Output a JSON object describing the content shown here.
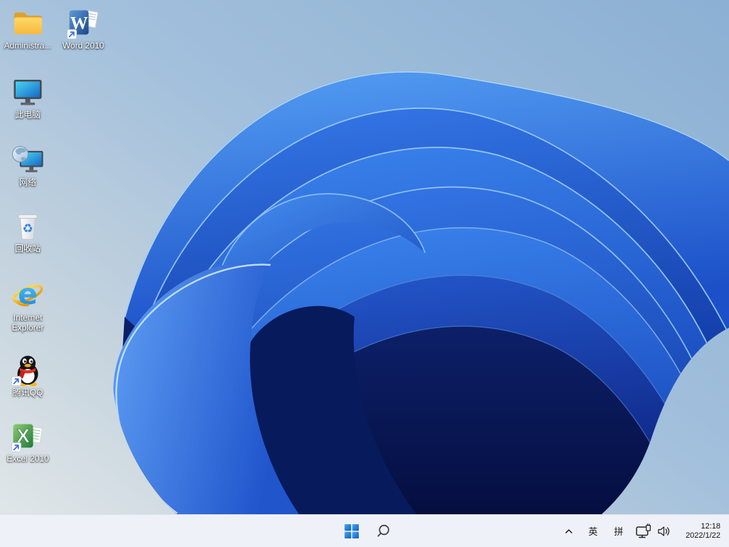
{
  "desktop": {
    "icons": [
      {
        "label": "Administra..."
      },
      {
        "label": "Word 2010"
      },
      {
        "label": "此电脑"
      },
      {
        "label": "网络"
      },
      {
        "label": "回收站"
      },
      {
        "label": "Internet Explorer"
      },
      {
        "label": "腾讯QQ"
      },
      {
        "label": "Excel 2010"
      }
    ],
    "icon_glyphs": {
      "word": "W",
      "excel": "X",
      "ie": "e",
      "recycle": "♻"
    }
  },
  "taskbar": {
    "start_icon": "windows-11-logo",
    "search_icon": "magnifier",
    "tray": {
      "chevron_icon": "chevron-up",
      "ime_language": "英",
      "ime_layout": "拼",
      "network_icon": "ethernet-display",
      "volume_icon": "speaker",
      "time": "12:18",
      "date": "2022/1/22"
    }
  },
  "wallpaper": {
    "name": "windows-11-bloom",
    "colors": {
      "sky_top_right": "#8bb0d3",
      "sky_bottom_left": "#e4e9ea",
      "bloom_bright": "#3b85ee",
      "bloom_dark": "#061048",
      "taskbar": "#eef1f7"
    }
  }
}
